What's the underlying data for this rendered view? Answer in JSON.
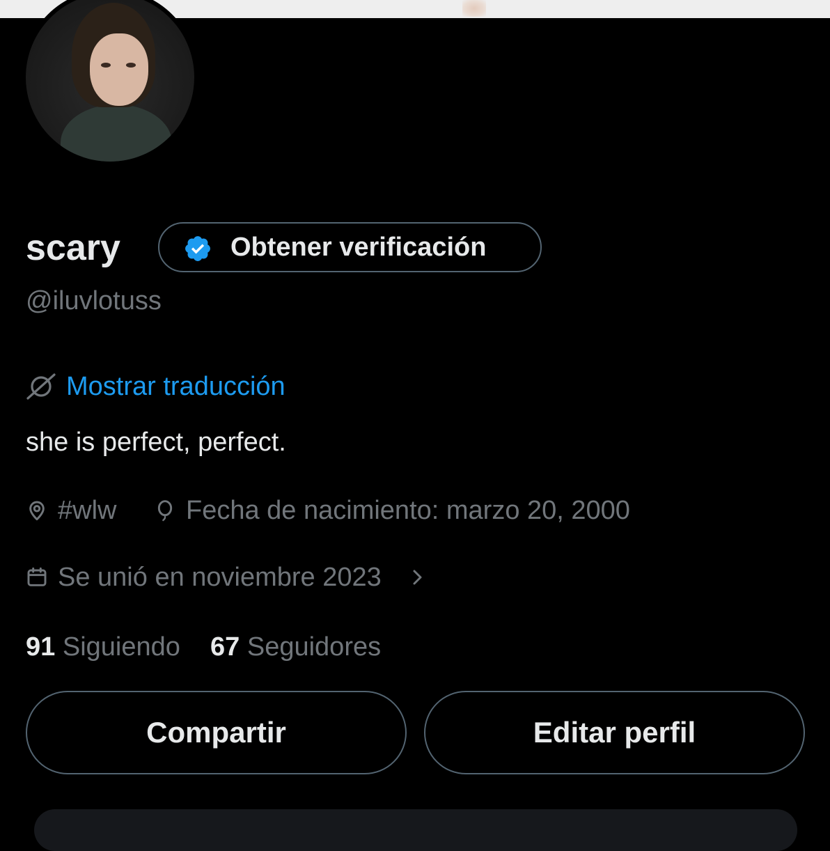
{
  "profile": {
    "display_name": "scary",
    "handle": "@iluvlotuss",
    "verify_button_label": "Obtener verificación",
    "translate_label": "Mostrar traducción",
    "bio": "she is perfect, perfect.",
    "location": "#wlw",
    "birthdate": "Fecha de nacimiento: marzo 20, 2000",
    "joined": "Se unió en noviembre 2023",
    "following_count": "91",
    "following_label": "Siguiendo",
    "followers_count": "67",
    "followers_label": "Seguidores"
  },
  "actions": {
    "share_label": "Compartir",
    "edit_label": "Editar perfil"
  },
  "icons": {
    "verified": "verified-badge-icon",
    "translate": "translate-icon",
    "location": "location-pin-icon",
    "birthday": "balloon-icon",
    "calendar": "calendar-icon",
    "chevron": "chevron-right-icon"
  },
  "colors": {
    "background": "#000000",
    "text_primary": "#e7e9ea",
    "text_secondary": "#71767b",
    "accent": "#1d9bf0",
    "border": "#536471"
  }
}
